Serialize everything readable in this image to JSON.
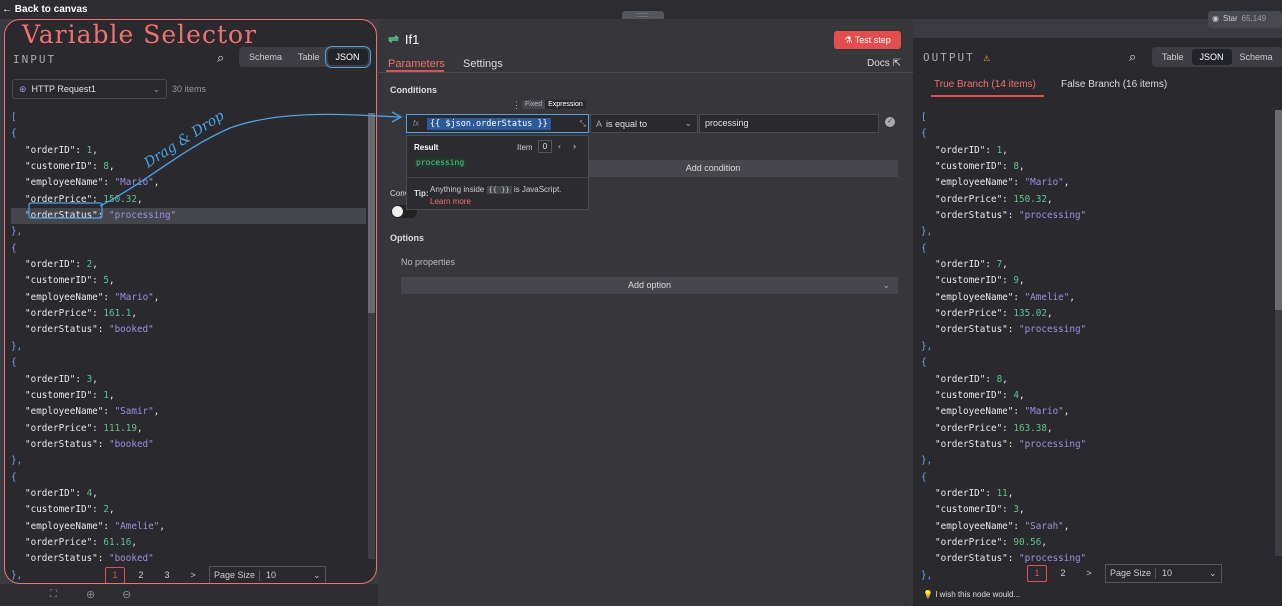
{
  "topbar": {
    "back_label": "Back to canvas",
    "drag_handle": "::::::",
    "github": {
      "star_label": "Star",
      "star_count": "65,149"
    }
  },
  "overlay": {
    "title": "Variable Selector",
    "drag_label": "Drag & Drop"
  },
  "input_panel": {
    "title": "INPUT",
    "views": [
      "Schema",
      "Table",
      "JSON"
    ],
    "active_view": "JSON",
    "source_node": "HTTP Request1",
    "item_count": "30 items",
    "records": [
      {
        "orderID": "1",
        "customerID": "8",
        "employeeName": "\"Mario\"",
        "orderPrice": "150.32",
        "orderStatus": "\"processing\""
      },
      {
        "orderID": "2",
        "customerID": "5",
        "employeeName": "\"Mario\"",
        "orderPrice": "161.1",
        "orderStatus": "\"booked\""
      },
      {
        "orderID": "3",
        "customerID": "1",
        "employeeName": "\"Samir\"",
        "orderPrice": "111.19",
        "orderStatus": "\"booked\""
      },
      {
        "orderID": "4",
        "customerID": "2",
        "employeeName": "\"Amelie\"",
        "orderPrice": "61.16",
        "orderStatus": "\"booked\""
      }
    ],
    "pages": [
      "1",
      "2",
      "3"
    ],
    "next_symbol": ">",
    "page_size_label": "Page Size",
    "page_size_value": "10"
  },
  "node": {
    "name": "If1",
    "test_button": "Test step",
    "tabs": [
      "Parameters",
      "Settings"
    ],
    "docs_label": "Docs",
    "conditions_label": "Conditions",
    "mode_fixed": "Fixed",
    "mode_expression": "Expression",
    "fx_label": "fx",
    "expression": "{{ $json.orderStatus }}",
    "operator": "is equal to",
    "operator_type_glyph": "A",
    "value": "processing",
    "result_label": "Result",
    "item_label": "Item",
    "item_index": "0",
    "result_value": "processing",
    "tip_label": "Tip:",
    "tip_text_before": "Anything inside",
    "tip_code": "{{ }}",
    "tip_text_after": "is JavaScript.",
    "learn_more": "Learn more",
    "add_condition": "Add condition",
    "convert_label": "Conv",
    "options_label": "Options",
    "no_properties": "No properties",
    "add_option": "Add option"
  },
  "output_panel": {
    "title": "OUTPUT",
    "views": [
      "Table",
      "JSON",
      "Schema"
    ],
    "active_view": "JSON",
    "true_branch": "True Branch (14 items)",
    "false_branch": "False Branch (16 items)",
    "records": [
      {
        "orderID": "1",
        "customerID": "8",
        "employeeName": "\"Mario\"",
        "orderPrice": "150.32",
        "orderStatus": "\"processing\""
      },
      {
        "orderID": "7",
        "customerID": "9",
        "employeeName": "\"Amelie\"",
        "orderPrice": "135.02",
        "orderStatus": "\"processing\""
      },
      {
        "orderID": "8",
        "customerID": "4",
        "employeeName": "\"Mario\"",
        "orderPrice": "163.38",
        "orderStatus": "\"processing\""
      },
      {
        "orderID": "11",
        "customerID": "3",
        "employeeName": "\"Sarah\"",
        "orderPrice": "90.56",
        "orderStatus": "\"processing\""
      }
    ],
    "pages": [
      "1",
      "2"
    ],
    "next_symbol": ">",
    "page_size_label": "Page Size",
    "page_size_value": "10",
    "feedback": "I wish this node would..."
  },
  "colors": {
    "accent": "#e24e4e",
    "annotation": "#f07070",
    "arrow": "#4aa3e8",
    "string": "#9d8fe0",
    "number": "#5cc28d"
  }
}
